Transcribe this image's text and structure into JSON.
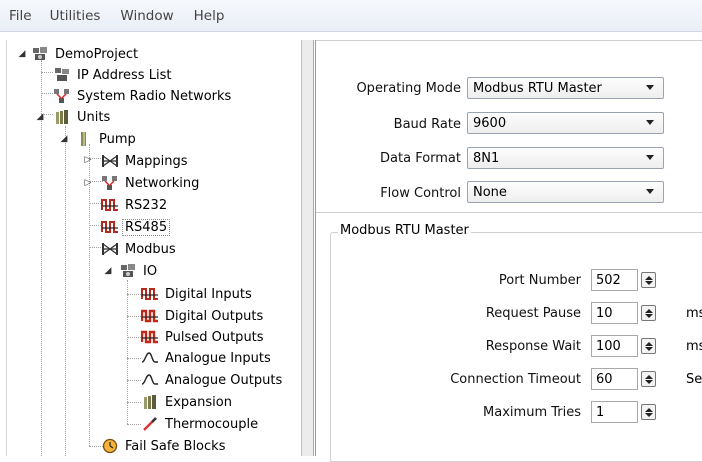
{
  "menu": {
    "items": [
      "File",
      "Utilities",
      "Window",
      "Help"
    ]
  },
  "tree": {
    "project": "DemoProject",
    "ip_address_list": "IP Address List",
    "system_radio_networks": "System Radio Networks",
    "units": "Units",
    "pump": "Pump",
    "mappings": "Mappings",
    "networking": "Networking",
    "rs232": "RS232",
    "rs485": "RS485",
    "modbus": "Modbus",
    "io": "IO",
    "digital_inputs": "Digital Inputs",
    "digital_outputs": "Digital Outputs",
    "pulsed_outputs": "Pulsed Outputs",
    "analogue_inputs": "Analogue Inputs",
    "analogue_outputs": "Analogue Outputs",
    "expansion": "Expansion",
    "thermocouple": "Thermocouple",
    "fail_safe_blocks": "Fail Safe Blocks",
    "selected": "RS485"
  },
  "settings": {
    "operating_mode": {
      "label": "Operating Mode",
      "value": "Modbus RTU Master"
    },
    "baud_rate": {
      "label": "Baud Rate",
      "value": "9600"
    },
    "data_format": {
      "label": "Data Format",
      "value": "8N1"
    },
    "flow_control": {
      "label": "Flow Control",
      "value": "None"
    }
  },
  "master_group": {
    "title": "Modbus RTU Master",
    "port_number": {
      "label": "Port Number",
      "value": "502",
      "unit": ""
    },
    "request_pause": {
      "label": "Request Pause",
      "value": "10",
      "unit": "ms"
    },
    "response_wait": {
      "label": "Response Wait",
      "value": "100",
      "unit": "ms"
    },
    "connection_timeout": {
      "label": "Connection Timeout",
      "value": "60",
      "unit": "Se"
    },
    "maximum_tries": {
      "label": "Maximum Tries",
      "value": "1",
      "unit": ""
    }
  },
  "colors": {
    "menubar_top": "#f6f8fc",
    "menubar_bottom": "#e9eef6",
    "rs_icon_red": "#c0392b",
    "thermo_red": "#d33"
  }
}
